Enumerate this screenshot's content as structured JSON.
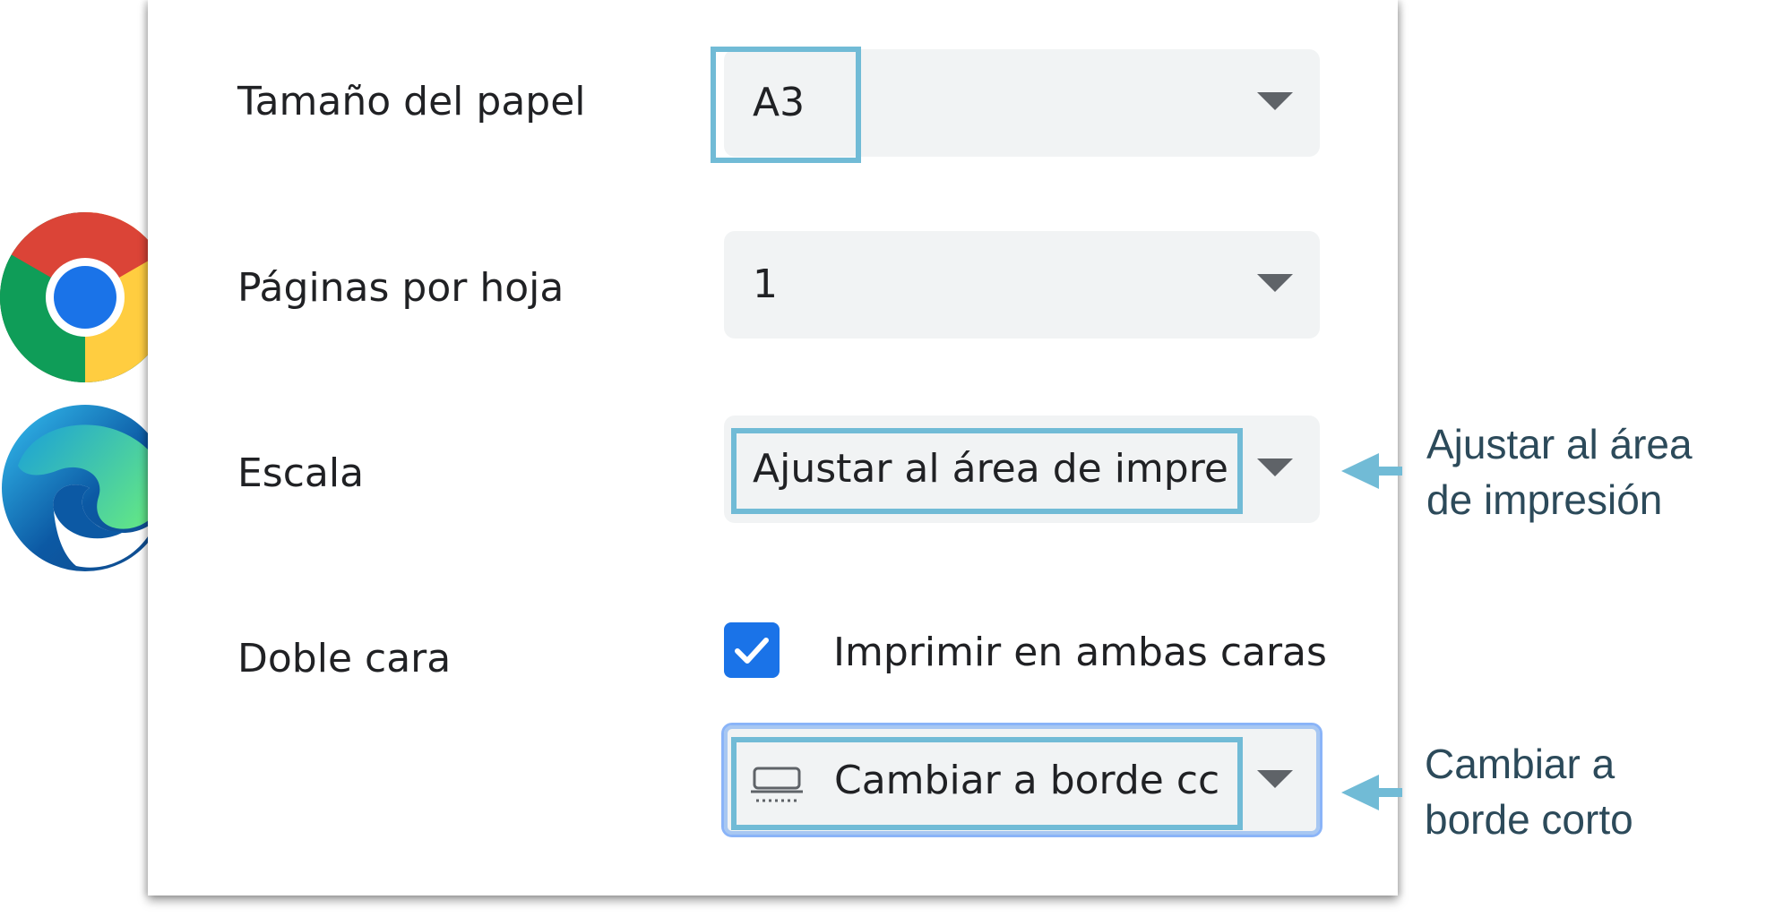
{
  "settings": {
    "paper_size": {
      "label": "Tamaño del papel",
      "value": "A3"
    },
    "pages_per_sheet": {
      "label": "Páginas por hoja",
      "value": "1"
    },
    "scale": {
      "label": "Escala",
      "value": "Ajustar al área de impre"
    },
    "duplex": {
      "label": "Doble cara",
      "checkbox_label": "Imprimir en ambas caras",
      "checked": true,
      "edge_value": "Cambiar a borde cc"
    }
  },
  "annotations": {
    "scale_note_line1": "Ajustar al área",
    "scale_note_line2": "de impresión",
    "edge_note_line1": "Cambiar a",
    "edge_note_line2": "borde corto"
  },
  "icons": {
    "chrome": "chrome-logo-icon",
    "edge": "edge-logo-icon",
    "caret": "caret-down-icon",
    "check": "checkmark-icon",
    "edge_flip": "short-edge-flip-icon"
  },
  "colors": {
    "highlight": "#71bbd6",
    "checkbox": "#1a73e8",
    "select_bg": "#f1f3f4",
    "annotation_text": "#2c4a5a"
  }
}
